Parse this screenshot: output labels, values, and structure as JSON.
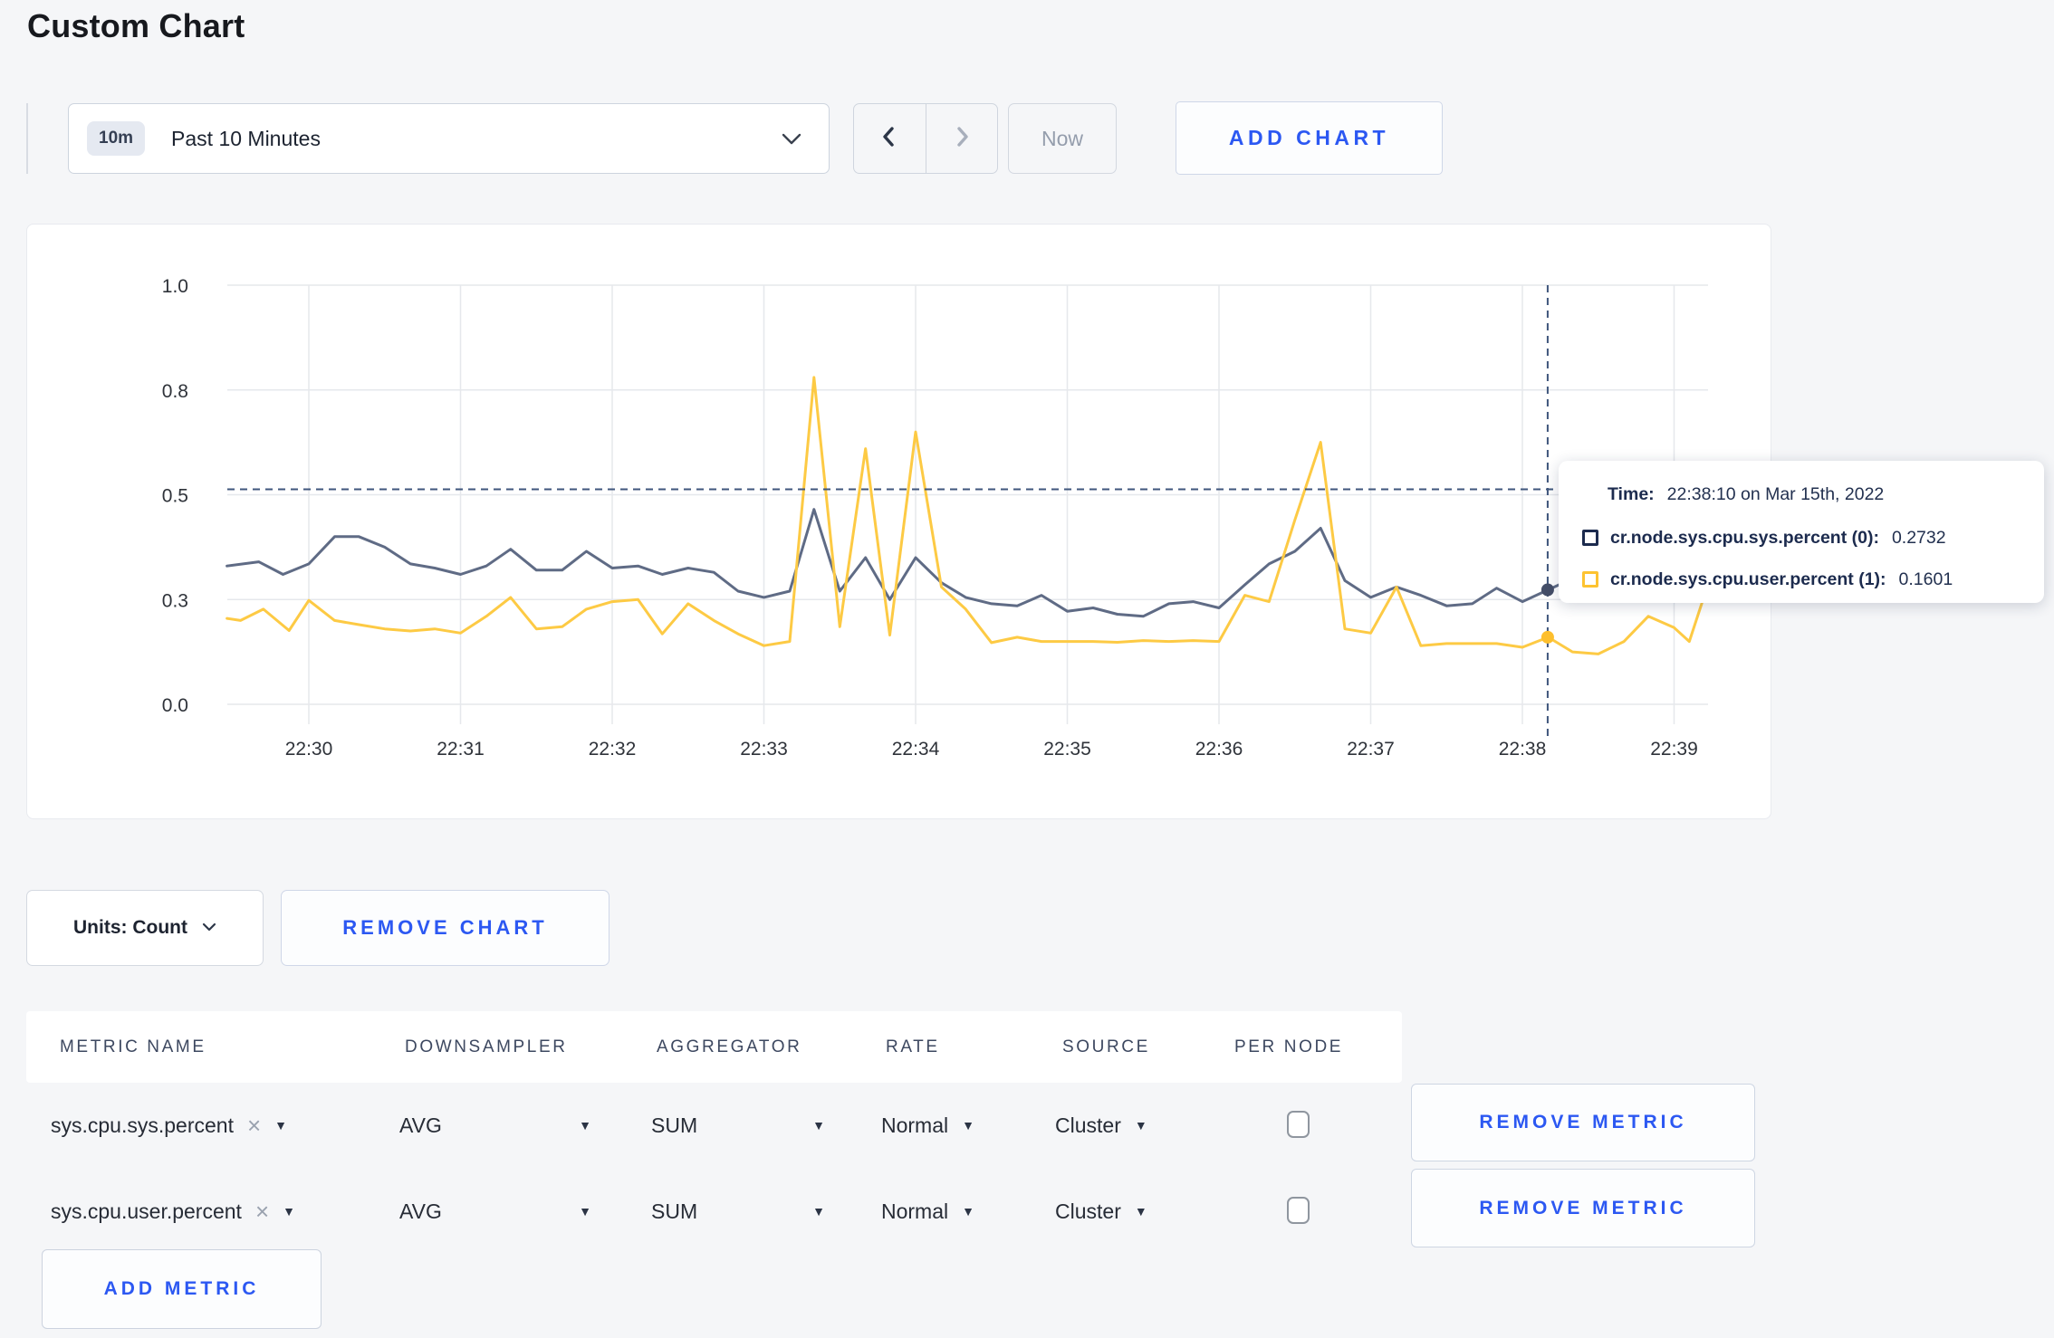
{
  "page": {
    "title": "Custom Chart",
    "accent_color": "#2c58f2",
    "background": "#f5f6f8"
  },
  "toolbar": {
    "time_range": {
      "badge": "10m",
      "label": "Past 10 Minutes"
    },
    "now_label": "Now",
    "add_chart_label": "ADD CHART"
  },
  "icons": {
    "caret_down": "▼",
    "close": "×"
  },
  "tooltip": {
    "time_label": "Time:",
    "time_value": "22:38:10 on Mar 15th, 2022",
    "rows": [
      {
        "name": "cr.node.sys.cpu.sys.percent (0):",
        "value": "0.2732",
        "color": "#1c2b4e"
      },
      {
        "name": "cr.node.sys.cpu.user.percent (1):",
        "value": "0.1601",
        "color": "#fdc331"
      }
    ]
  },
  "units": {
    "label": "Units: Count"
  },
  "remove_chart_label": "REMOVE CHART",
  "table": {
    "headers": [
      "METRIC NAME",
      "DOWNSAMPLER",
      "AGGREGATOR",
      "RATE",
      "SOURCE",
      "PER NODE"
    ],
    "rows": [
      {
        "metric": "sys.cpu.sys.percent",
        "downsampler": "AVG",
        "aggregator": "SUM",
        "rate": "Normal",
        "source": "Cluster",
        "per_node_checked": false,
        "remove_label": "REMOVE METRIC"
      },
      {
        "metric": "sys.cpu.user.percent",
        "downsampler": "AVG",
        "aggregator": "SUM",
        "rate": "Normal",
        "source": "Cluster",
        "per_node_checked": false,
        "remove_label": "REMOVE METRIC"
      }
    ],
    "add_metric_label": "ADD METRIC"
  },
  "chart_data": {
    "type": "line",
    "title": "",
    "xlabel": "",
    "ylabel": "",
    "grid": true,
    "legend_position": "tooltip-only",
    "grid_color": "#e6e8ec",
    "tick_color": "#2f333a",
    "ylim": [
      0,
      1
    ],
    "x_ticks": [
      "22:30",
      "22:31",
      "22:32",
      "22:33",
      "22:34",
      "22:35",
      "22:36",
      "22:37",
      "22:38",
      "22:39"
    ],
    "y_ticks": {
      "values": [
        0,
        0.25,
        0.5,
        0.75,
        1
      ],
      "labels": [
        "0.0",
        "0.3",
        "0.5",
        "0.8",
        "1.0"
      ]
    },
    "x_unit": "minutes after 22:30 on Mar 15th, 2022",
    "series": [
      {
        "name": "cr.node.sys.cpu.sys.percent",
        "color": "#5f6b85",
        "points": [
          [
            -0.54,
            0.33
          ],
          [
            -0.33,
            0.34
          ],
          [
            -0.17,
            0.31
          ],
          [
            0,
            0.335
          ],
          [
            0.17,
            0.4
          ],
          [
            0.33,
            0.4
          ],
          [
            0.5,
            0.375
          ],
          [
            0.67,
            0.335
          ],
          [
            0.83,
            0.325
          ],
          [
            1,
            0.31
          ],
          [
            1.17,
            0.33
          ],
          [
            1.33,
            0.37
          ],
          [
            1.5,
            0.32
          ],
          [
            1.67,
            0.32
          ],
          [
            1.83,
            0.365
          ],
          [
            2,
            0.325
          ],
          [
            2.17,
            0.33
          ],
          [
            2.33,
            0.31
          ],
          [
            2.5,
            0.325
          ],
          [
            2.67,
            0.315
          ],
          [
            2.83,
            0.27
          ],
          [
            3,
            0.255
          ],
          [
            3.17,
            0.27
          ],
          [
            3.33,
            0.465
          ],
          [
            3.5,
            0.27
          ],
          [
            3.67,
            0.35
          ],
          [
            3.83,
            0.25
          ],
          [
            4,
            0.35
          ],
          [
            4.17,
            0.29
          ],
          [
            4.33,
            0.255
          ],
          [
            4.5,
            0.24
          ],
          [
            4.67,
            0.235
          ],
          [
            4.83,
            0.26
          ],
          [
            5,
            0.222
          ],
          [
            5.17,
            0.23
          ],
          [
            5.33,
            0.215
          ],
          [
            5.5,
            0.21
          ],
          [
            5.67,
            0.24
          ],
          [
            5.83,
            0.245
          ],
          [
            6,
            0.23
          ],
          [
            6.17,
            0.285
          ],
          [
            6.33,
            0.335
          ],
          [
            6.5,
            0.365
          ],
          [
            6.67,
            0.42
          ],
          [
            6.83,
            0.295
          ],
          [
            7,
            0.255
          ],
          [
            7.17,
            0.28
          ],
          [
            7.33,
            0.26
          ],
          [
            7.5,
            0.235
          ],
          [
            7.67,
            0.24
          ],
          [
            7.83,
            0.277
          ],
          [
            8,
            0.245
          ],
          [
            8.17,
            0.2732
          ],
          [
            8.33,
            0.3
          ],
          [
            8.5,
            0.31
          ],
          [
            8.67,
            0.3
          ],
          [
            8.83,
            0.29
          ],
          [
            9,
            0.3
          ],
          [
            9.2,
            0.3
          ]
        ]
      },
      {
        "name": "cr.node.sys.cpu.user.percent",
        "color": "#fdca44",
        "points": [
          [
            -0.54,
            0.205
          ],
          [
            -0.45,
            0.2
          ],
          [
            -0.3,
            0.227
          ],
          [
            -0.13,
            0.176
          ],
          [
            0,
            0.248
          ],
          [
            0.17,
            0.2
          ],
          [
            0.33,
            0.19
          ],
          [
            0.5,
            0.18
          ],
          [
            0.67,
            0.175
          ],
          [
            0.83,
            0.18
          ],
          [
            1,
            0.17
          ],
          [
            1.17,
            0.21
          ],
          [
            1.33,
            0.255
          ],
          [
            1.5,
            0.18
          ],
          [
            1.67,
            0.185
          ],
          [
            1.83,
            0.227
          ],
          [
            2,
            0.245
          ],
          [
            2.17,
            0.25
          ],
          [
            2.33,
            0.168
          ],
          [
            2.5,
            0.24
          ],
          [
            2.67,
            0.2
          ],
          [
            2.83,
            0.168
          ],
          [
            3,
            0.14
          ],
          [
            3.17,
            0.15
          ],
          [
            3.33,
            0.78
          ],
          [
            3.5,
            0.185
          ],
          [
            3.67,
            0.61
          ],
          [
            3.83,
            0.165
          ],
          [
            4,
            0.65
          ],
          [
            4.17,
            0.28
          ],
          [
            4.33,
            0.227
          ],
          [
            4.5,
            0.147
          ],
          [
            4.67,
            0.16
          ],
          [
            4.83,
            0.15
          ],
          [
            5,
            0.15
          ],
          [
            5.17,
            0.15
          ],
          [
            5.33,
            0.148
          ],
          [
            5.5,
            0.152
          ],
          [
            5.67,
            0.15
          ],
          [
            5.83,
            0.152
          ],
          [
            6,
            0.15
          ],
          [
            6.17,
            0.26
          ],
          [
            6.33,
            0.245
          ],
          [
            6.5,
            0.44
          ],
          [
            6.67,
            0.625
          ],
          [
            6.83,
            0.18
          ],
          [
            7,
            0.17
          ],
          [
            7.17,
            0.28
          ],
          [
            7.33,
            0.14
          ],
          [
            7.5,
            0.145
          ],
          [
            7.67,
            0.145
          ],
          [
            7.83,
            0.145
          ],
          [
            8,
            0.136
          ],
          [
            8.17,
            0.1601
          ],
          [
            8.33,
            0.125
          ],
          [
            8.5,
            0.12
          ],
          [
            8.67,
            0.15
          ],
          [
            8.83,
            0.21
          ],
          [
            9,
            0.183
          ],
          [
            9.1,
            0.15
          ],
          [
            9.2,
            0.26
          ]
        ]
      }
    ],
    "crosshair": {
      "x": 8.1667,
      "y": 0.513,
      "color": "#3f567c",
      "time": "22:38:10"
    },
    "highlight_points": [
      {
        "series": 0,
        "x": 8.1667,
        "y": 0.2732,
        "color": "#444e68"
      },
      {
        "series": 1,
        "x": 8.1667,
        "y": 0.1601,
        "color": "#fdbf2d"
      }
    ]
  }
}
